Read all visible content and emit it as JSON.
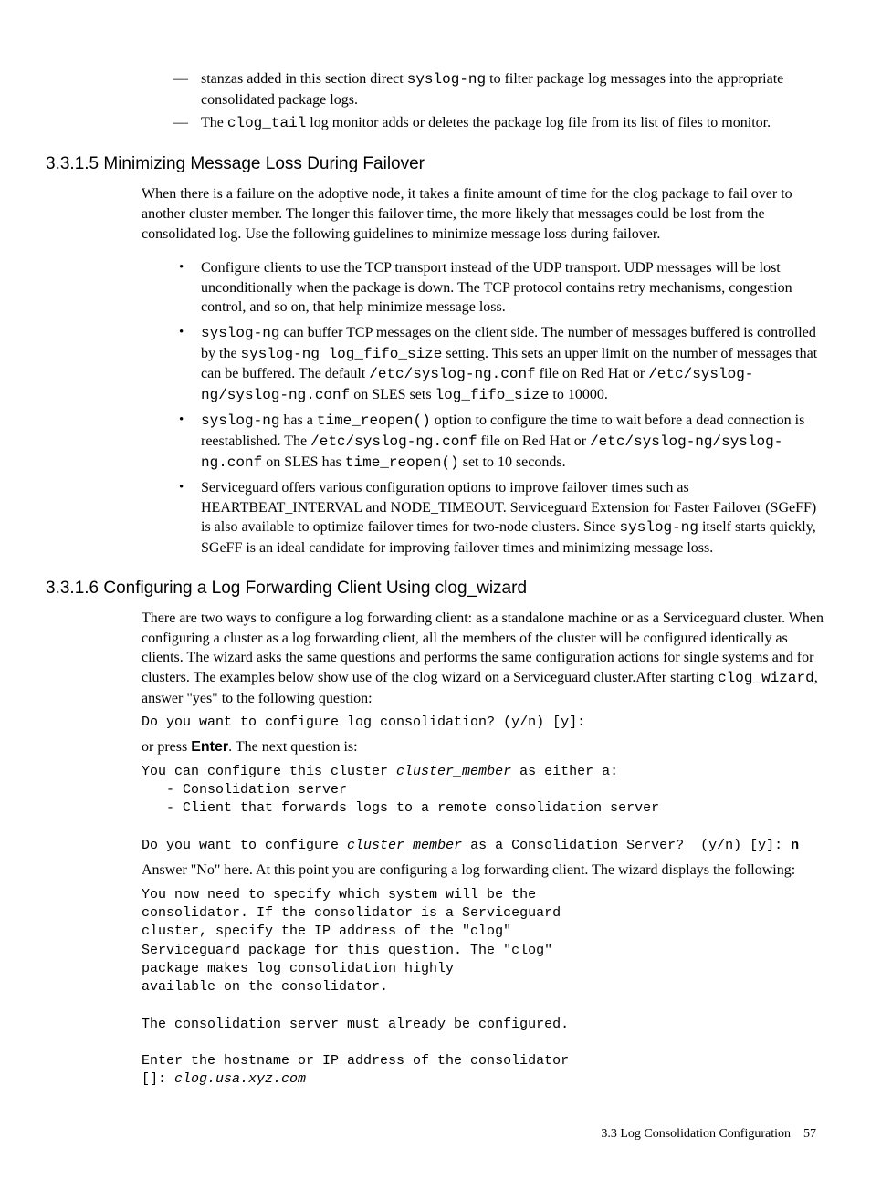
{
  "intro_list": {
    "item1_pre": "stanzas added in this section direct ",
    "item1_code": "syslog-ng",
    "item1_post": " to filter package log messages into the appropriate consolidated package logs.",
    "item2_pre": "The ",
    "item2_code": "clog_tail",
    "item2_post": " log monitor adds or deletes the package log file from its list of files to monitor."
  },
  "section_3315": {
    "heading": "3.3.1.5 Minimizing Message Loss During Failover",
    "para": "When there is a failure on the adoptive node, it takes a finite amount of time for the clog package to fail over to another cluster member. The longer this failover time, the more likely that messages could be lost from the consolidated log. Use the following guidelines to minimize message loss during failover.",
    "bullets": {
      "b1": "Configure clients to use the TCP transport instead of the UDP transport. UDP messages will be lost unconditionally when the package is down. The TCP protocol contains retry mechanisms, congestion control, and so on, that help minimize message loss.",
      "b2_c1": "syslog-ng",
      "b2_t1": " can buffer TCP messages on the client side. The number of messages buffered is controlled by the ",
      "b2_c2": "syslog-ng log_fifo_size",
      "b2_t2": " setting. This sets an upper limit on the number of messages that can be buffered. The default ",
      "b2_c3": "/etc/syslog-ng.conf",
      "b2_t3": " file on Red Hat or ",
      "b2_c4": "/etc/syslog-ng/syslog-ng.conf",
      "b2_t4": " on SLES sets ",
      "b2_c5": "log_fifo_size",
      "b2_t5": " to 10000.",
      "b3_c1": "syslog-ng",
      "b3_t1": " has a ",
      "b3_c2": "time_reopen()",
      "b3_t2": " option to configure the time to wait before a dead connection is reestablished. The ",
      "b3_c3": "/etc/syslog-ng.conf",
      "b3_t3": " file on Red Hat or ",
      "b3_c4": "/etc/syslog-ng/syslog-ng.conf",
      "b3_t4": " on SLES has ",
      "b3_c5": "time_reopen()",
      "b3_t5": " set to 10 seconds.",
      "b4_t1": "Serviceguard offers various configuration options to improve failover times such as HEARTBEAT_INTERVAL and NODE_TIMEOUT. Serviceguard Extension for Faster Failover (SGeFF) is also available to optimize failover times for two-node clusters. Since ",
      "b4_c1": "syslog-ng",
      "b4_t2": " itself starts quickly, SGeFF is an ideal candidate for improving failover times and minimizing message loss."
    }
  },
  "section_3316": {
    "heading": "3.3.1.6 Configuring a Log Forwarding Client Using clog_wizard",
    "para1_t1": "There are two ways to configure a log forwarding client: as a standalone machine or as a Serviceguard cluster. When configuring a cluster as a log forwarding client, all the members of the cluster will be configured identically as clients. The wizard asks the same questions and performs the same configuration actions for single systems and for clusters. The examples below show use of the clog wizard on a Serviceguard cluster.After starting ",
    "para1_c1": "clog_wizard",
    "para1_t2": ", answer \"yes\" to the following question:",
    "code1": "Do you want to configure log consolidation? (y/n) [y]:",
    "para2_t1": "or press ",
    "para2_bold": "Enter",
    "para2_t2": ". The next question is:",
    "code2_l1a": "You can configure this cluster ",
    "code2_l1b": "cluster_member",
    "code2_l1c": " as either a:",
    "code2_l2": "   - Consolidation server",
    "code2_l3": "   - Client that forwards logs to a remote consolidation server",
    "code2_l4a": "Do you want to configure ",
    "code2_l4b": "cluster_member",
    "code2_l4c": " as a Consolidation Server?  (y/n) [y]: ",
    "code2_l4d": "n",
    "para3": "Answer \"No\" here. At this point you are configuring a log forwarding client. The wizard displays the following:",
    "code3_block": "You now need to specify which system will be the\nconsolidator. If the consolidator is a Serviceguard\ncluster, specify the IP address of the \"clog\"\nServiceguard package for this question. The \"clog\"\npackage makes log consolidation highly\navailable on the consolidator.\n\nThe consolidation server must already be configured.\n\nEnter the hostname or IP address of the consolidator",
    "code3_last_a": "[]: ",
    "code3_last_b": "clog.usa.xyz.com"
  },
  "footer": {
    "section": "3.3 Log Consolidation Configuration",
    "page": "57"
  }
}
